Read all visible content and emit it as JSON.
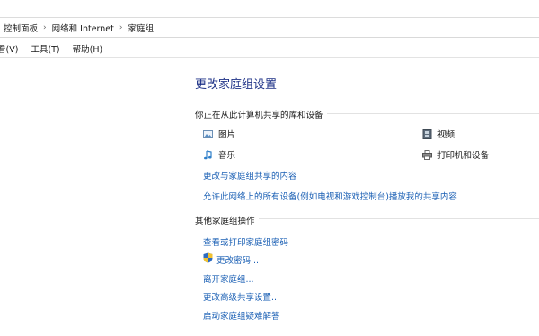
{
  "breadcrumb": {
    "items": [
      "控制面板",
      "网络和 Internet",
      "家庭组"
    ],
    "separator": "›"
  },
  "menu": {
    "items": [
      "看(V)",
      "工具(T)",
      "帮助(H)"
    ]
  },
  "page": {
    "title": "更改家庭组设置"
  },
  "shared_section": {
    "title": "你正在从此计算机共享的库和设备",
    "libraries": [
      {
        "label": "图片",
        "icon": "pictures-icon"
      },
      {
        "label": "视频",
        "icon": "videos-icon"
      },
      {
        "label": "音乐",
        "icon": "music-icon"
      },
      {
        "label": "打印机和设备",
        "icon": "printer-icon"
      }
    ],
    "links": [
      "更改与家庭组共享的内容",
      "允许此网络上的所有设备(例如电视和游戏控制台)播放我的共享内容"
    ]
  },
  "actions_section": {
    "title": "其他家庭组操作",
    "links": [
      {
        "label": "查看或打印家庭组密码",
        "icon": ""
      },
      {
        "label": "更改密码...",
        "icon": "uac-shield-icon"
      },
      {
        "label": "离开家庭组...",
        "icon": ""
      },
      {
        "label": "更改高级共享设置...",
        "icon": ""
      },
      {
        "label": "启动家庭组疑难解答",
        "icon": ""
      }
    ]
  },
  "colors": {
    "title": "#1e3287",
    "link": "#1a5fb4",
    "line": "#e2e2e2"
  }
}
